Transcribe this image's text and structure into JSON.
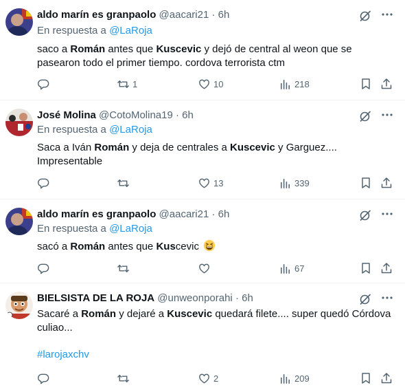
{
  "reply_prefix": "En respuesta a",
  "tweets": [
    {
      "name": "aldo marín es granpaolo",
      "handle": "@aacari21",
      "time": "6h",
      "reply_to": "@LaRoja",
      "body": [
        "saco a ",
        "Román",
        " antes que ",
        "Kuscevic",
        " y dejó de central al weon que se pasearon todo el primer tiempo. cordova terrorista ctm"
      ],
      "replies": "",
      "retweets": "1",
      "likes": "10",
      "views": "218"
    },
    {
      "name": "José Molina",
      "handle": "@CotoMolina19",
      "time": "6h",
      "reply_to": "@LaRoja",
      "body": [
        "Saca a Iván ",
        "Román",
        " y deja de centrales a ",
        "Kuscevic",
        " y Garguez.... Impresentable"
      ],
      "replies": "",
      "retweets": "",
      "likes": "13",
      "views": "339"
    },
    {
      "name": "aldo marín es granpaolo",
      "handle": "@aacari21",
      "time": "6h",
      "reply_to": "@LaRoja",
      "body": [
        "sacó a ",
        "Román",
        " antes que ",
        "Kus",
        "cevic"
      ],
      "emoji": "grinning-squinting-face",
      "replies": "",
      "retweets": "",
      "likes": "",
      "views": "67"
    },
    {
      "name": "BIELSISTA DE LA ROJA",
      "handle": "@unweonporahi",
      "time": "6h",
      "reply_to": "",
      "body": [
        "Sacaré a ",
        "Román",
        " y dejaré a ",
        "Kuscevic",
        " quedará filete.... super quedó Córdova culiao..."
      ],
      "hashtag": "#larojaxchv",
      "replies": "",
      "retweets": "",
      "likes": "2",
      "views": "209"
    }
  ],
  "dot": "·",
  "colors": {
    "accent": "#1d9bf0",
    "secondary": "#536471",
    "text": "#0f1419",
    "border": "#eff3f4"
  },
  "icons": [
    "grok-icon",
    "more-icon",
    "reply-icon",
    "retweet-icon",
    "like-icon",
    "views-icon",
    "bookmark-icon",
    "share-icon"
  ]
}
